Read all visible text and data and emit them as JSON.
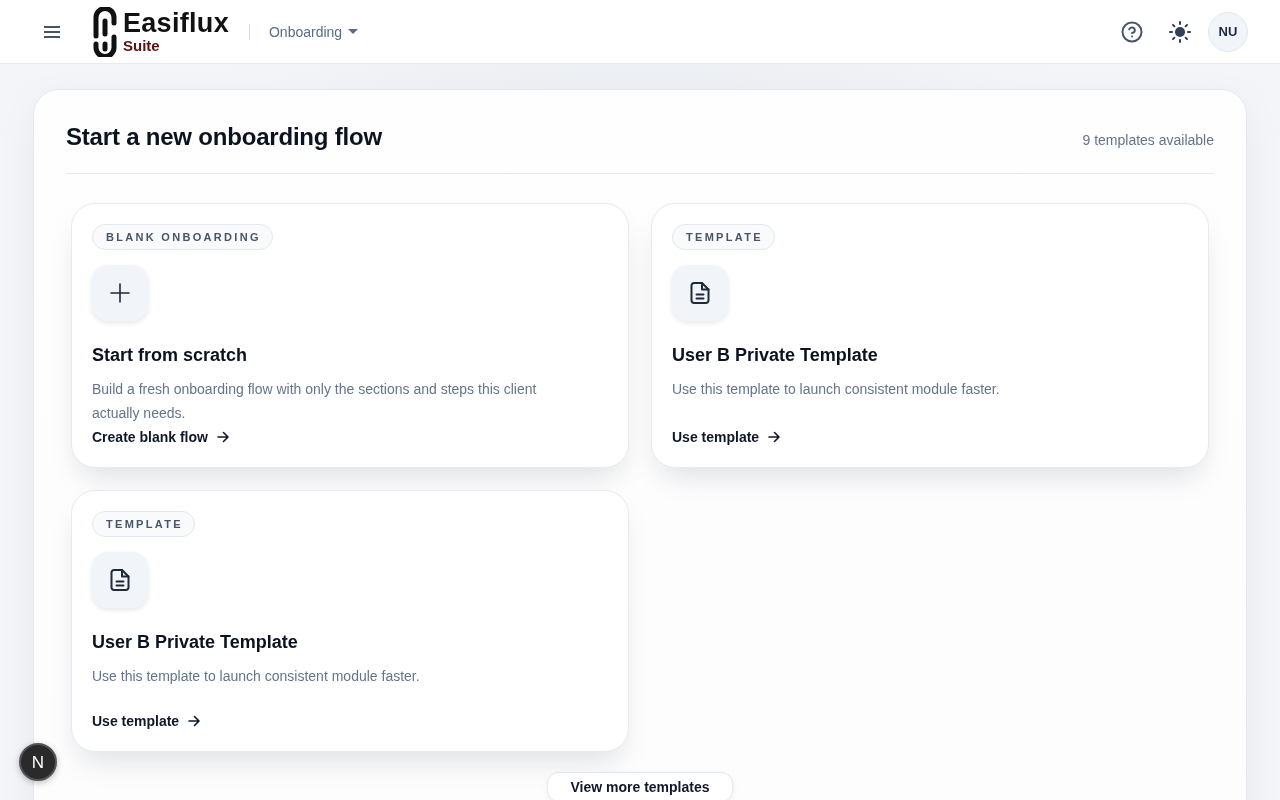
{
  "header": {
    "brand": {
      "name": "Easiflux",
      "suffix": "Suite"
    },
    "module_menu": {
      "label": "Onboarding"
    },
    "avatar": {
      "initials": "NU"
    }
  },
  "panel": {
    "title": "Start a new onboarding flow",
    "count": "9 templates available",
    "cards": [
      {
        "kind": "blank",
        "badge": "BLANK ONBOARDING",
        "title": "Start from scratch",
        "description": "Build a fresh onboarding flow with only the sections and steps this client actually needs.",
        "action": "Create blank flow"
      },
      {
        "kind": "template",
        "badge": "TEMPLATE",
        "title": "User B Private Template",
        "description": "Use this template to launch consistent module faster.",
        "action": "Use template"
      },
      {
        "kind": "template",
        "badge": "TEMPLATE",
        "title": "User B Private Template",
        "description": "Use this template to launch consistent module faster.",
        "action": "Use template"
      }
    ],
    "more_button": "View more templates"
  },
  "dev_badge": {
    "label": "N"
  }
}
